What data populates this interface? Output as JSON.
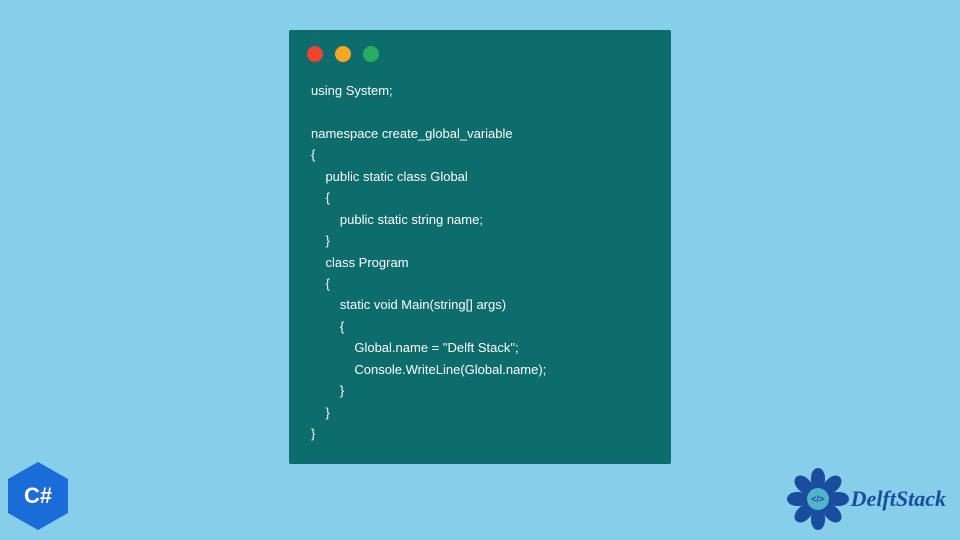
{
  "code": {
    "lines": [
      "using System;",
      "",
      "namespace create_global_variable",
      "{",
      "    public static class Global",
      "    {",
      "        public static string name;",
      "    }",
      "    class Program",
      "    {",
      "        static void Main(string[] args)",
      "        {",
      "            Global.name = \"Delft Stack\";",
      "            Console.WriteLine(Global.name);",
      "        }",
      "    }",
      "}"
    ]
  },
  "badge": {
    "label": "C#"
  },
  "brand": {
    "name": "DelftStack",
    "emblem_glyph": "</>"
  },
  "colors": {
    "page_bg": "#87ceeb",
    "window_bg": "#0d6d6d",
    "dot_red": "#ec4332",
    "dot_yellow": "#f5a623",
    "dot_green": "#27ae60",
    "csharp_bg": "#1a6dd9",
    "brand_color": "#1a4d9e"
  }
}
